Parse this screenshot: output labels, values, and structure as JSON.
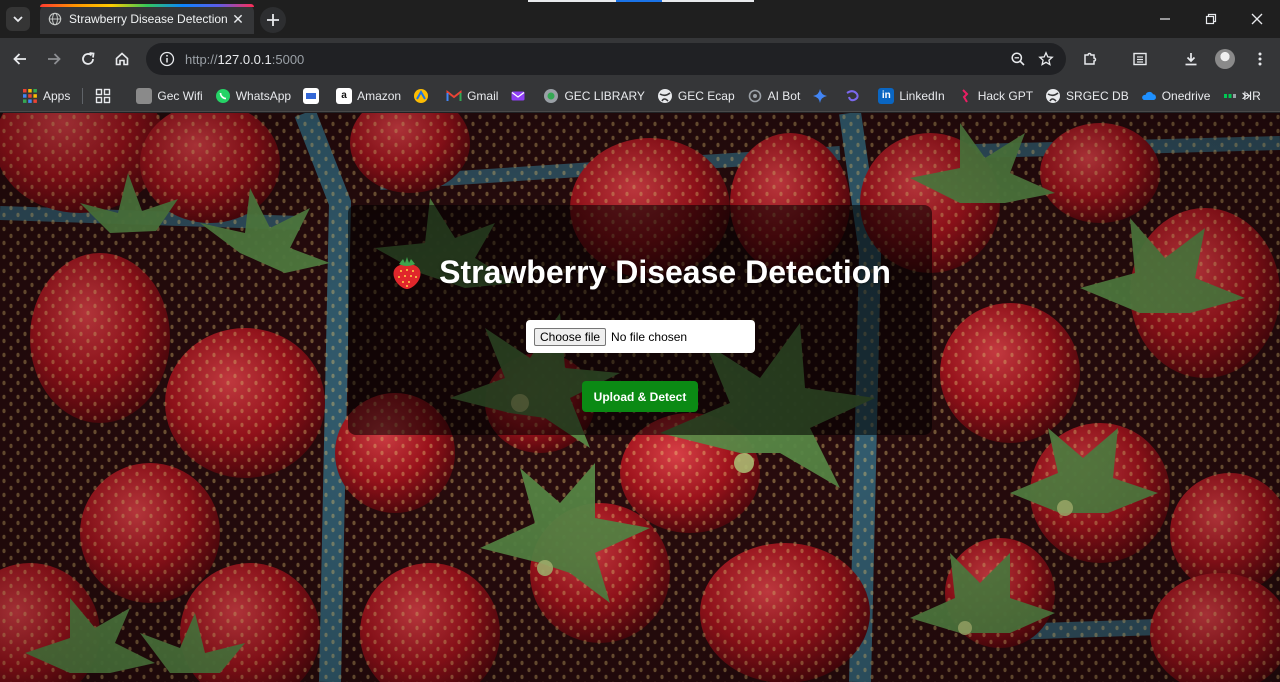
{
  "browser": {
    "tab": {
      "title": "Strawberry Disease Detection"
    },
    "omnibox": {
      "scheme": "http://",
      "host": "127.0.0.1",
      "port": ":5000"
    },
    "bookmarks": [
      {
        "label": "Apps",
        "icon": "apps-grid-icon",
        "color": "#e8eaed"
      },
      {
        "label": "",
        "icon": "grid-icon",
        "color": "#e8eaed"
      },
      {
        "label": "Gec Wifi",
        "icon": "gec-wifi-icon",
        "color": "#8a8a8a"
      },
      {
        "label": "WhatsApp",
        "icon": "whatsapp-icon",
        "color": "#25d366"
      },
      {
        "label": "",
        "icon": "generic-site-icon",
        "color": "#ffffff"
      },
      {
        "label": "Amazon",
        "icon": "amazon-icon",
        "color": "#ffffff"
      },
      {
        "label": "",
        "icon": "badge-icon",
        "color": "#fbbc04"
      },
      {
        "label": "Gmail",
        "icon": "gmail-icon",
        "color": "#ea4335"
      },
      {
        "label": "",
        "icon": "mail-icon",
        "color": "#8f3ff5"
      },
      {
        "label": "GEC LIBRARY",
        "icon": "library-icon",
        "color": "#9aa0a6"
      },
      {
        "label": "GEC Ecap",
        "icon": "globe-icon",
        "color": "#e8eaed"
      },
      {
        "label": "AI Bot",
        "icon": "bot-icon",
        "color": "#9aa0a6"
      },
      {
        "label": "",
        "icon": "sparkle-icon",
        "color": "#4285f4"
      },
      {
        "label": "",
        "icon": "swirl-icon",
        "color": "#7b68ee"
      },
      {
        "label": "LinkedIn",
        "icon": "linkedin-icon",
        "color": "#0a66c2"
      },
      {
        "label": "Hack GPT",
        "icon": "hackgpt-icon",
        "color": "#e91e63"
      },
      {
        "label": "SRGEC DB",
        "icon": "globe-icon",
        "color": "#e8eaed"
      },
      {
        "label": "Onedrive",
        "icon": "cloud-icon",
        "color": "#1e90ff"
      },
      {
        "label": "HR",
        "icon": "hr-icon",
        "color": "#00c853"
      }
    ]
  },
  "page": {
    "heading": "Strawberry Disease Detection",
    "heading_icon": "strawberry-icon",
    "file_input": {
      "button_label": "Choose file",
      "status": "No file chosen"
    },
    "submit_label": "Upload & Detect",
    "colors": {
      "submit": "#0b8a14",
      "panel": "rgba(0,0,0,0.55)"
    }
  }
}
